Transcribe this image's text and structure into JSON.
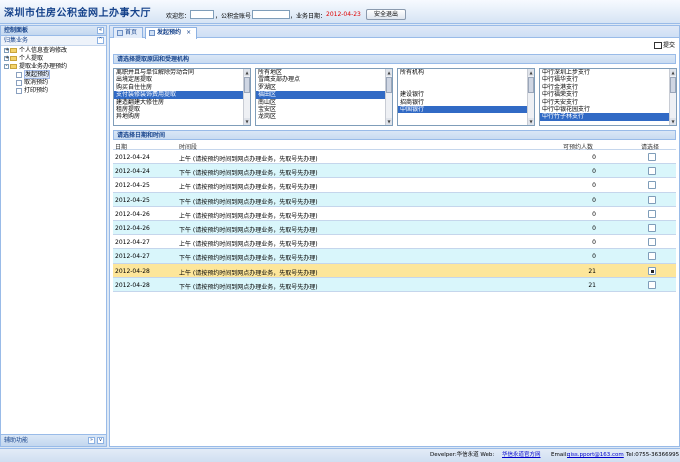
{
  "app": {
    "title": "深圳市住房公积金网上办事大厅"
  },
  "header": {
    "welcome_label": "欢迎您：",
    "account_label": "，公积金账号：",
    "date_label": "，业务日期：",
    "business_date": "2012-04-23",
    "logout_label": "安全退出"
  },
  "sidebar": {
    "title": "控制面板",
    "section": "归集业务",
    "tree": [
      {
        "label": "个人信息查询修改",
        "level": 0,
        "expand": "+"
      },
      {
        "label": "个人提取",
        "level": 0,
        "expand": "+"
      },
      {
        "label": "提取业务办理预约",
        "level": 0,
        "expand": "-"
      },
      {
        "label": "发起预约",
        "level": 1,
        "selected": true
      },
      {
        "label": "取消预约",
        "level": 1
      },
      {
        "label": "打印预约",
        "level": 1
      }
    ],
    "footer": "辅助功能"
  },
  "tabs": [
    {
      "label": "首页"
    },
    {
      "label": "发起预约",
      "active": true,
      "close": "×"
    }
  ],
  "toolbar": {
    "submit_label": "提交"
  },
  "section1_title": "请选择提取原因和受理机构",
  "lists": {
    "reasons": [
      {
        "label": "离职并且与单位解除劳动合同"
      },
      {
        "label": "出境定居提取"
      },
      {
        "label": "购买自住住房"
      },
      {
        "label": "支付装修装饰费用提取",
        "selected": true
      },
      {
        "label": "建造翻建大修住房"
      },
      {
        "label": "租房提取"
      },
      {
        "label": "异地购房"
      }
    ],
    "districts": [
      {
        "label": "所有地区"
      },
      {
        "label": "雪鹰支部办理点"
      },
      {
        "label": "罗湖区"
      },
      {
        "label": "福田区",
        "selected": true
      },
      {
        "label": "南山区"
      },
      {
        "label": "宝安区"
      },
      {
        "label": "龙岗区"
      }
    ],
    "banks": [
      {
        "label": "所有机构"
      },
      {
        "label": ""
      },
      {
        "label": ""
      },
      {
        "label": "建设银行"
      },
      {
        "label": "招商银行"
      },
      {
        "label": "中国银行",
        "selected": true
      }
    ],
    "branches": [
      {
        "label": "中行深圳上步支行"
      },
      {
        "label": "中行福华支行"
      },
      {
        "label": "中行金港支行"
      },
      {
        "label": "中行福荣支行"
      },
      {
        "label": "中行天安支行"
      },
      {
        "label": "中行中银花园支行"
      },
      {
        "label": "中行竹子林支行",
        "selected": true
      }
    ]
  },
  "section2_title": "请选择日期和时间",
  "grid": {
    "columns": {
      "date": "日期",
      "slot": "时间段",
      "count": "可预约人数",
      "choose": "请选择"
    },
    "rows": [
      {
        "date": "2012-04-24",
        "slot": "上午 (请按预约时间到网点办理业务，先取号先办理)",
        "count": "0"
      },
      {
        "date": "2012-04-24",
        "slot": "下午 (请按预约时间到网点办理业务，先取号先办理)",
        "count": "0"
      },
      {
        "date": "2012-04-25",
        "slot": "上午 (请按预约时间到网点办理业务，先取号先办理)",
        "count": "0"
      },
      {
        "date": "2012-04-25",
        "slot": "下午 (请按预约时间到网点办理业务，先取号先办理)",
        "count": "0"
      },
      {
        "date": "2012-04-26",
        "slot": "上午 (请按预约时间到网点办理业务，先取号先办理)",
        "count": "0"
      },
      {
        "date": "2012-04-26",
        "slot": "下午 (请按预约时间到网点办理业务，先取号先办理)",
        "count": "0"
      },
      {
        "date": "2012-04-27",
        "slot": "上午 (请按预约时间到网点办理业务，先取号先办理)",
        "count": "0"
      },
      {
        "date": "2012-04-27",
        "slot": "下午 (请按预约时间到网点办理业务，先取号先办理)",
        "count": "0"
      },
      {
        "date": "2012-04-28",
        "slot": "上午 (请按预约时间到网点办理业务，先取号先办理)",
        "count": "21",
        "selected": true
      },
      {
        "date": "2012-04-28",
        "slot": "下午 (请按预约时间到网点办理业务，先取号先办理)",
        "count": "21"
      }
    ]
  },
  "footer": {
    "dev_label": "Develper:华信永道 Web:",
    "web_link": "华信永道官方网",
    "email_label": "Email:",
    "email": "qiss.pport@163.com",
    "tel": "Tel:0755-36366995"
  },
  "colors": {
    "accent": "#15428b",
    "selected_row": "#fde69a",
    "alt_row": "#d9f6fb",
    "list_selection": "#316ac5",
    "date": "#e00000"
  }
}
